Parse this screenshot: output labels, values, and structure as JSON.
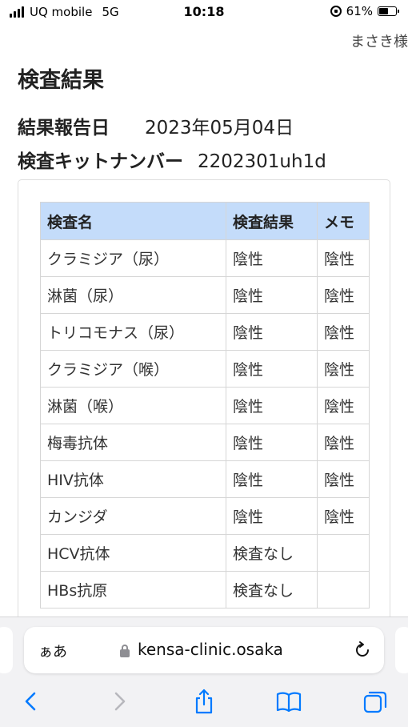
{
  "status_bar": {
    "carrier": "UQ mobile",
    "network": "5G",
    "time": "10:18",
    "battery_percent": "61%",
    "battery_level": 0.61
  },
  "header": {
    "user_name": "まさき様"
  },
  "page": {
    "title": "検査結果",
    "report_date_label": "結果報告日",
    "report_date_value": "2023年05月04日",
    "kit_number_label": "検査キットナンバー",
    "kit_number_value": "2202301uh1d"
  },
  "results_table": {
    "headers": [
      "検査名",
      "検査結果",
      "メモ"
    ],
    "header_color": "#c4dcfa",
    "rows": [
      [
        "クラミジア（尿）",
        "陰性",
        "陰性"
      ],
      [
        "淋菌（尿）",
        "陰性",
        "陰性"
      ],
      [
        "トリコモナス（尿）",
        "陰性",
        "陰性"
      ],
      [
        "クラミジア（喉）",
        "陰性",
        "陰性"
      ],
      [
        "淋菌（喉）",
        "陰性",
        "陰性"
      ],
      [
        "梅毒抗体",
        "陰性",
        "陰性"
      ],
      [
        "HIV抗体",
        "陰性",
        "陰性"
      ],
      [
        "カンジダ",
        "陰性",
        "陰性"
      ],
      [
        "HCV抗体",
        "検査なし",
        ""
      ],
      [
        "HBs抗原",
        "検査なし",
        ""
      ]
    ]
  },
  "browser": {
    "aa_label": "ぁあ",
    "url": "kensa-clinic.osaka",
    "accent_color": "#007aff",
    "icons": [
      "lock-icon",
      "reload-icon",
      "back-icon",
      "forward-icon",
      "share-icon",
      "bookmarks-icon",
      "tabs-icon"
    ]
  }
}
